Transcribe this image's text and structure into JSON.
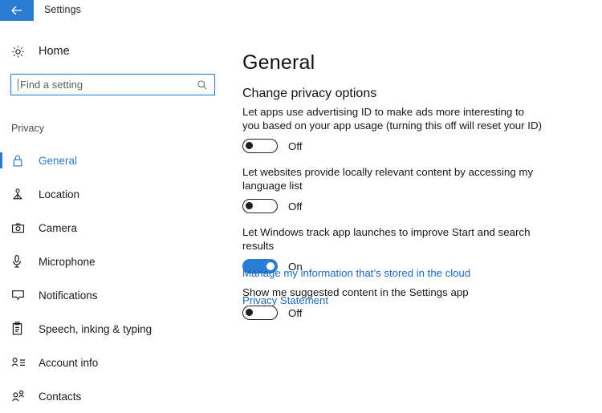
{
  "titlebar": {
    "back_icon": "arrow-left-icon",
    "title": "Settings",
    "accent_color": "#2b7cd3"
  },
  "sidebar": {
    "home": {
      "icon": "gear-icon",
      "label": "Home"
    },
    "search": {
      "icon": "search-icon",
      "placeholder": "Find a setting",
      "value": ""
    },
    "group_title": "Privacy",
    "items": [
      {
        "icon": "lock-icon",
        "label": "General",
        "selected": true
      },
      {
        "icon": "location-icon",
        "label": "Location",
        "selected": false
      },
      {
        "icon": "camera-icon",
        "label": "Camera",
        "selected": false
      },
      {
        "icon": "microphone-icon",
        "label": "Microphone",
        "selected": false
      },
      {
        "icon": "notification-icon",
        "label": "Notifications",
        "selected": false
      },
      {
        "icon": "clipboard-icon",
        "label": "Speech, inking & typing",
        "selected": false
      },
      {
        "icon": "account-info-icon",
        "label": "Account info",
        "selected": false
      },
      {
        "icon": "contacts-icon",
        "label": "Contacts",
        "selected": false
      }
    ]
  },
  "main": {
    "page_title": "General",
    "section_title": "Change privacy options",
    "settings": [
      {
        "label": "Let apps use advertising ID to make ads more interesting to you based on your app usage (turning this off will reset your ID)",
        "state": "Off",
        "on": false
      },
      {
        "label": "Let websites provide locally relevant content by accessing my language list",
        "state": "Off",
        "on": false
      },
      {
        "label": "Let Windows track app launches to improve Start and search results",
        "state": "On",
        "on": true
      },
      {
        "label": "Show me suggested content in the Settings app",
        "state": "Off",
        "on": false
      }
    ],
    "links": [
      {
        "label": "Manage my information that’s stored in the cloud"
      },
      {
        "label": "Privacy Statement"
      }
    ],
    "link_color": "#1a6bbf"
  }
}
